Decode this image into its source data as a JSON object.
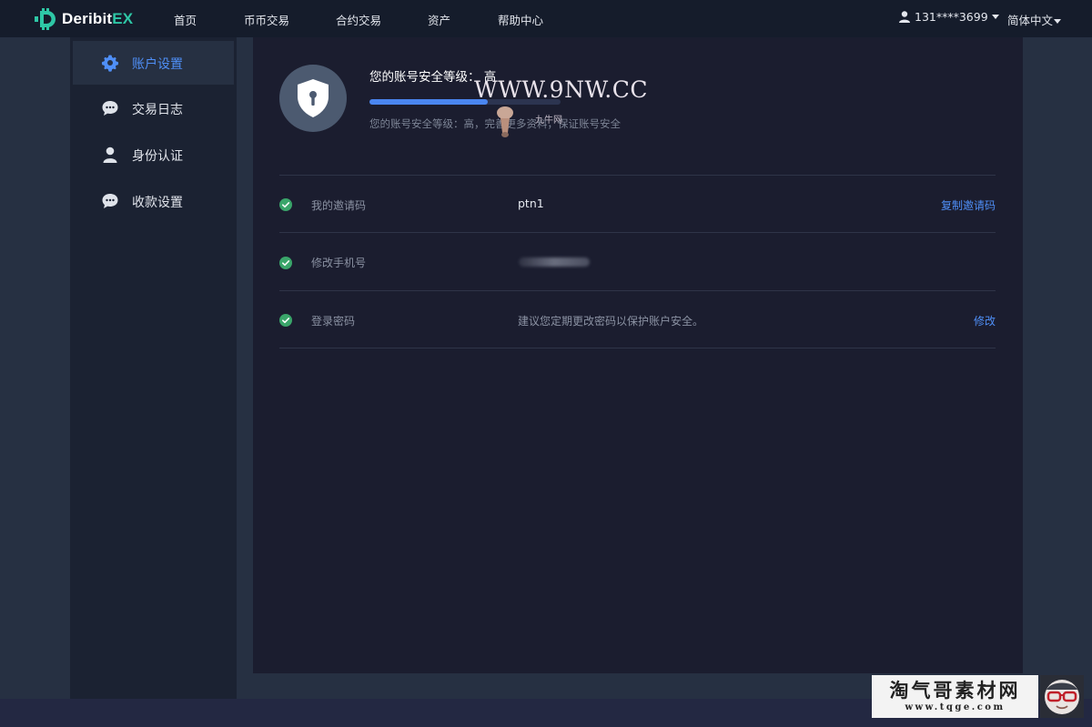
{
  "header": {
    "logo_main": "Deribit",
    "logo_accent": "EX",
    "nav": [
      {
        "label": "首页"
      },
      {
        "label": "币币交易"
      },
      {
        "label": "合约交易"
      },
      {
        "label": "资产"
      },
      {
        "label": "帮助中心"
      }
    ],
    "user": "131****3699",
    "language": "简体中文"
  },
  "sidebar": {
    "items": [
      {
        "label": "账户设置",
        "icon": "gear-icon",
        "active": true
      },
      {
        "label": "交易日志",
        "icon": "chat-bubble-icon",
        "active": false
      },
      {
        "label": "身份认证",
        "icon": "user-icon",
        "active": false
      },
      {
        "label": "收款设置",
        "icon": "chat-bubble-icon",
        "active": false
      }
    ]
  },
  "security": {
    "title": "您的账号安全等级： 高",
    "level_fraction": 0.62,
    "description": "您的账号安全等级：高，完善更多资料，保证账号安全"
  },
  "settings": {
    "invite": {
      "label": "我的邀请码",
      "value": "ptn1",
      "action": "复制邀请码"
    },
    "phone": {
      "label": "修改手机号"
    },
    "password": {
      "label": "登录密码",
      "value": "建议您定期更改密码以保护账户安全。",
      "action": "修改"
    }
  },
  "watermark": {
    "url": "WWW.9NW.CC",
    "text": "九牛网"
  },
  "badge": {
    "title": "淘气哥素材网",
    "url": "www.tqge.com"
  },
  "colors": {
    "accent": "#4f8ff7",
    "brand": "#2ec7a6",
    "success": "#3aa56a"
  }
}
